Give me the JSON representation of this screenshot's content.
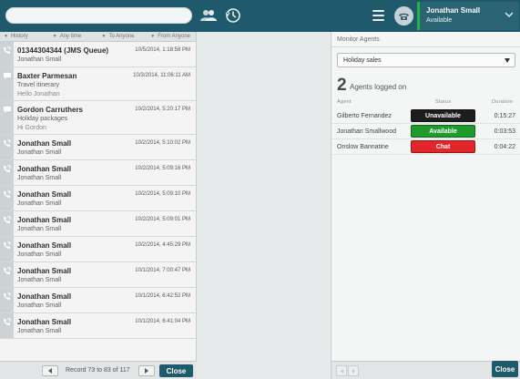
{
  "topbar": {
    "search_placeholder": "",
    "user_name": "Jonathan Small",
    "user_status": "Available",
    "status_color": "#27b445",
    "icons": [
      "contacts-icon",
      "history-icon",
      "menu-icon",
      "phone-icon",
      "chevron-down-icon"
    ]
  },
  "history": {
    "filters": [
      "History",
      "Any time",
      "To Anyone",
      "From Anyone"
    ],
    "items": [
      {
        "icon": "call-icon",
        "name": "01344304344 (JMS Queue)",
        "date": "10/5/2014, 1:18:58 PM",
        "sub1": "Jonathan Small",
        "sub2": ""
      },
      {
        "icon": "chat-icon",
        "name": "Baxter Parmesan",
        "date": "10/3/2014, 11:06:11 AM",
        "sub1": "Travel itinerary",
        "sub2": "Hello Jonathan"
      },
      {
        "icon": "chat-icon",
        "name": "Gordon Carruthers",
        "date": "10/2/2014, 5:20:17 PM",
        "sub1": "Holiday packages",
        "sub2": "Hi Gordon"
      },
      {
        "icon": "call-icon",
        "name": "Jonathan Small",
        "date": "10/2/2014, 5:10:02 PM",
        "sub1": "Jonathan Small",
        "sub2": ""
      },
      {
        "icon": "call-icon",
        "name": "Jonathan Small",
        "date": "10/2/2014, 5:09:16 PM",
        "sub1": "Jonathan Small",
        "sub2": ""
      },
      {
        "icon": "call-icon",
        "name": "Jonathan Small",
        "date": "10/2/2014, 5:09:10 PM",
        "sub1": "Jonathan Small",
        "sub2": ""
      },
      {
        "icon": "call-icon",
        "name": "Jonathan Small",
        "date": "10/2/2014, 5:09:01 PM",
        "sub1": "Jonathan Small",
        "sub2": ""
      },
      {
        "icon": "call-icon",
        "name": "Jonathan Small",
        "date": "10/2/2014, 4:45:29 PM",
        "sub1": "Jonathan Small",
        "sub2": ""
      },
      {
        "icon": "call-icon",
        "name": "Jonathan Small",
        "date": "10/1/2014, 7:00:47 PM",
        "sub1": "Jonathan Small",
        "sub2": ""
      },
      {
        "icon": "call-icon",
        "name": "Jonathan Small",
        "date": "10/1/2014, 6:42:52 PM",
        "sub1": "Jonathan Small",
        "sub2": ""
      },
      {
        "icon": "call-icon",
        "name": "Jonathan Small",
        "date": "10/1/2014, 6:41:04 PM",
        "sub1": "Jonathan Small",
        "sub2": ""
      }
    ],
    "pager_text": "Record 73 to 83 of 117",
    "close_label": "Close"
  },
  "monitor": {
    "title": "Monitor Agents",
    "selected_group": "Holiday sales",
    "count": "2",
    "count_label": "Agents logged on",
    "col_agent": "Agent",
    "col_status": "Status",
    "col_duration": "Duration",
    "agents": [
      {
        "name": "Gilberto Fernandez",
        "status": "Unavailable",
        "color": "#1d1d1d",
        "duration": "0:15:27"
      },
      {
        "name": "Jonathan Smallwood",
        "status": "Available",
        "color": "#1f9a2c",
        "duration": "0:03:53"
      },
      {
        "name": "Onslow Bannatine",
        "status": "Chat",
        "color": "#e3262a",
        "duration": "0:04:22"
      }
    ],
    "close_label": "Close"
  }
}
